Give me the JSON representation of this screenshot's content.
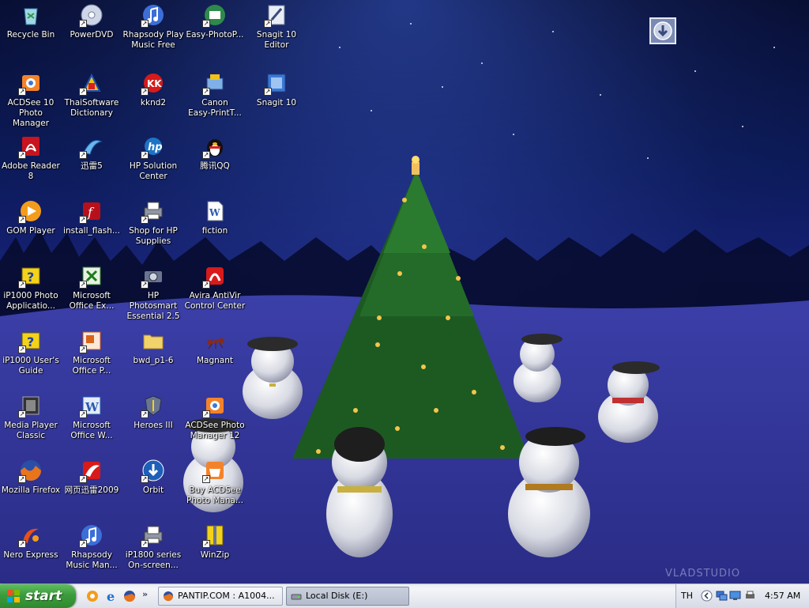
{
  "desktop": {
    "icons": [
      {
        "label": "Recycle Bin",
        "col": 0,
        "row": 0,
        "icon": "recycle-bin-icon",
        "shortcut": false
      },
      {
        "label": "PowerDVD",
        "col": 1,
        "row": 0,
        "icon": "dvd-icon",
        "shortcut": true
      },
      {
        "label": "Rhapsody Play\nMusic Free",
        "col": 2,
        "row": 0,
        "icon": "music-icon",
        "shortcut": true
      },
      {
        "label": "Easy-PhotoP...",
        "col": 3,
        "row": 0,
        "icon": "photo-print-icon",
        "shortcut": true
      },
      {
        "label": "Snagit 10\nEditor",
        "col": 4,
        "row": 0,
        "icon": "snagit-editor-icon",
        "shortcut": true
      },
      {
        "label": "ACDSee 10\nPhoto Manager",
        "col": 0,
        "row": 1,
        "icon": "acdsee-icon",
        "shortcut": true
      },
      {
        "label": "ThaiSoftware\nDictionary",
        "col": 1,
        "row": 1,
        "icon": "dictionary-icon",
        "shortcut": true
      },
      {
        "label": "kknd2",
        "col": 2,
        "row": 1,
        "icon": "game-icon",
        "shortcut": true
      },
      {
        "label": "Canon\nEasy-PrintT...",
        "col": 3,
        "row": 1,
        "icon": "canon-print-icon",
        "shortcut": true
      },
      {
        "label": "Snagit 10",
        "col": 4,
        "row": 1,
        "icon": "snagit-icon",
        "shortcut": true
      },
      {
        "label": "Adobe Reader\n8",
        "col": 0,
        "row": 2,
        "icon": "pdf-icon",
        "shortcut": true
      },
      {
        "label": "迅雷5",
        "col": 1,
        "row": 2,
        "icon": "thunder-icon",
        "shortcut": true
      },
      {
        "label": "HP Solution\nCenter",
        "col": 2,
        "row": 2,
        "icon": "hp-icon",
        "shortcut": true
      },
      {
        "label": "腾讯QQ",
        "col": 3,
        "row": 2,
        "icon": "qq-penguin-icon",
        "shortcut": true
      },
      {
        "label": "GOM Player",
        "col": 0,
        "row": 3,
        "icon": "media-player-icon",
        "shortcut": true
      },
      {
        "label": "install_flash...",
        "col": 1,
        "row": 3,
        "icon": "flash-icon",
        "shortcut": true
      },
      {
        "label": "Shop for HP\nSupplies",
        "col": 2,
        "row": 3,
        "icon": "printer-icon",
        "shortcut": true
      },
      {
        "label": "fiction",
        "col": 3,
        "row": 3,
        "icon": "word-document-icon",
        "shortcut": false
      },
      {
        "label": "iP1000 Photo\nApplicatio...",
        "col": 0,
        "row": 4,
        "icon": "help-book-icon",
        "shortcut": true
      },
      {
        "label": "Microsoft\nOffice Ex...",
        "col": 1,
        "row": 4,
        "icon": "excel-icon",
        "shortcut": true
      },
      {
        "label": "HP Photosmart\nEssential 2.5",
        "col": 2,
        "row": 4,
        "icon": "camera-icon",
        "shortcut": true
      },
      {
        "label": "Avira AntiVir\nControl Center",
        "col": 3,
        "row": 4,
        "icon": "antivirus-icon",
        "shortcut": true
      },
      {
        "label": "iP1000 User's\nGuide",
        "col": 0,
        "row": 5,
        "icon": "help-book-icon",
        "shortcut": true
      },
      {
        "label": "Microsoft\nOffice P...",
        "col": 1,
        "row": 5,
        "icon": "powerpoint-icon",
        "shortcut": true
      },
      {
        "label": "bwd_p1-6",
        "col": 2,
        "row": 5,
        "icon": "folder-icon",
        "shortcut": false
      },
      {
        "label": "Magnant",
        "col": 3,
        "row": 5,
        "icon": "ant-icon",
        "shortcut": false
      },
      {
        "label": "Media Player\nClassic",
        "col": 0,
        "row": 6,
        "icon": "film-icon",
        "shortcut": true
      },
      {
        "label": "Microsoft\nOffice W...",
        "col": 1,
        "row": 6,
        "icon": "word-icon",
        "shortcut": true
      },
      {
        "label": "Heroes III",
        "col": 2,
        "row": 6,
        "icon": "shield-icon",
        "shortcut": true
      },
      {
        "label": "ACDSee Photo\nManager 12",
        "col": 3,
        "row": 6,
        "icon": "acdsee-icon",
        "shortcut": true
      },
      {
        "label": "Mozilla Firefox",
        "col": 0,
        "row": 7,
        "icon": "firefox-icon",
        "shortcut": true
      },
      {
        "label": "网页迅雷2009",
        "col": 1,
        "row": 7,
        "icon": "thunder-web-icon",
        "shortcut": true
      },
      {
        "label": "Orbit",
        "col": 2,
        "row": 7,
        "icon": "download-icon",
        "shortcut": true
      },
      {
        "label": "Buy ACDSee\nPhoto Mana...",
        "col": 3,
        "row": 7,
        "icon": "shopping-basket-icon",
        "shortcut": true
      },
      {
        "label": "Nero Express",
        "col": 0,
        "row": 8,
        "icon": "nero-icon",
        "shortcut": true
      },
      {
        "label": "Rhapsody\nMusic Man...",
        "col": 1,
        "row": 8,
        "icon": "music-icon",
        "shortcut": true
      },
      {
        "label": "iP1800 series\nOn-screen...",
        "col": 2,
        "row": 8,
        "icon": "printer-icon",
        "shortcut": true
      },
      {
        "label": "WinZip",
        "col": 3,
        "row": 8,
        "icon": "winzip-icon",
        "shortcut": true
      }
    ],
    "watermark": "VLADSTUDIO"
  },
  "taskbar": {
    "start_label": "start",
    "tasks": [
      {
        "label": "PANTIP.COM : A1004...",
        "icon": "firefox-icon",
        "active": false
      },
      {
        "label": "Local Disk (E:)",
        "icon": "drive-icon",
        "active": true
      }
    ],
    "language": "TH",
    "clock": "4:57 AM"
  }
}
